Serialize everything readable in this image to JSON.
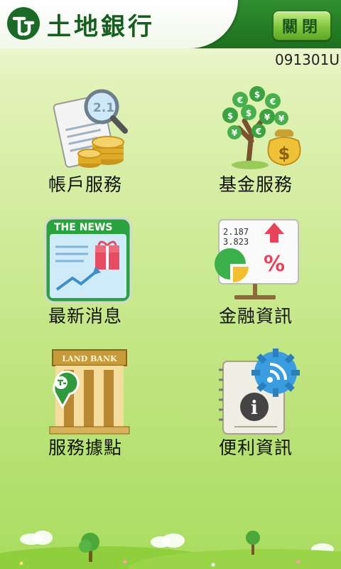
{
  "header": {
    "brand_name": "土地銀行",
    "close_label": "關閉"
  },
  "version_code": "091301U",
  "menu": [
    {
      "id": "account",
      "label": "帳戶服務",
      "icon": "document-magnifier-coins-icon"
    },
    {
      "id": "fund",
      "label": "基金服務",
      "icon": "money-tree-icon"
    },
    {
      "id": "news",
      "label": "最新消息",
      "icon": "the-news-icon"
    },
    {
      "id": "finance",
      "label": "金融資訊",
      "icon": "chart-percent-icon"
    },
    {
      "id": "branches",
      "label": "服務據點",
      "icon": "land-bank-building-icon"
    },
    {
      "id": "convenience",
      "label": "便利資訊",
      "icon": "info-notebook-rss-icon"
    }
  ],
  "icons_text": {
    "news_banner": "THE NEWS",
    "bank_sign": "LAND BANK",
    "stock_1": "2.187",
    "stock_2": "3.823",
    "doc_num": "2.1"
  },
  "colors": {
    "header_green": "#2f8f2f",
    "brand_text": "#165d20",
    "button_green": "#7fc43c",
    "background_bottom": "#a9dc5f"
  }
}
